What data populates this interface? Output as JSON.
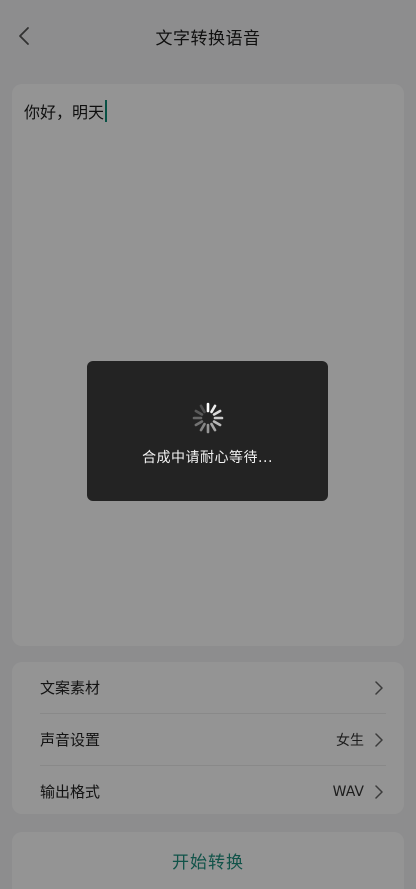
{
  "header": {
    "title": "文字转换语音",
    "back_icon": "chevron-left-icon"
  },
  "editor": {
    "text": "你好，明天"
  },
  "settings": {
    "rows": [
      {
        "label": "文案素材",
        "value": ""
      },
      {
        "label": "声音设置",
        "value": "女生"
      },
      {
        "label": "输出格式",
        "value": "WAV"
      }
    ]
  },
  "start_button": {
    "label": "开始转换"
  },
  "loading": {
    "text": "合成中请耐心等待..."
  },
  "colors": {
    "accent": "#1e8f7f",
    "caret": "#0f8c78",
    "overlay": "rgba(0,0,0,0.42)",
    "dialog": "#232323"
  }
}
